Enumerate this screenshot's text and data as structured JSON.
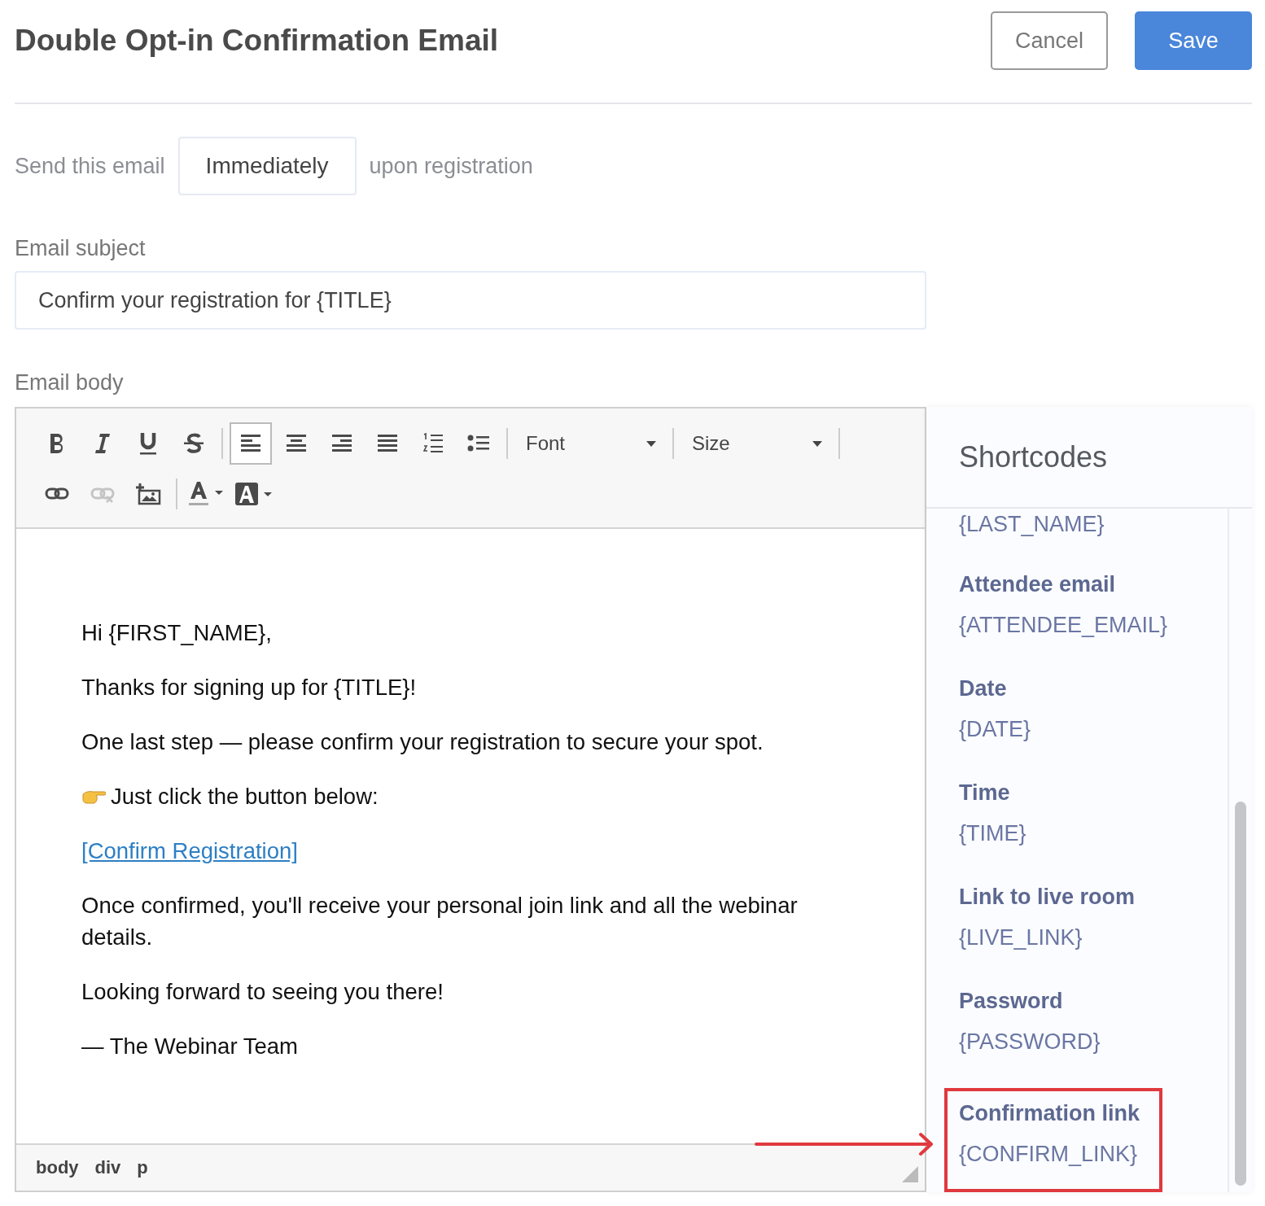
{
  "header": {
    "title": "Double Opt-in Confirmation Email",
    "buttons": [
      {
        "label": "Cancel",
        "kind": "secondary"
      },
      {
        "label": "Save",
        "kind": "primary"
      }
    ]
  },
  "timing": {
    "before": "Send this email",
    "value": "Immediately",
    "after": "upon registration"
  },
  "subject": {
    "label": "Email subject",
    "value": "Confirm your registration for {TITLE}"
  },
  "body_label": "Email body",
  "toolbar": {
    "rows": [
      [
        {
          "kind": "button",
          "selected": false
        },
        {
          "kind": "button",
          "selected": false
        },
        {
          "kind": "button",
          "selected": false
        },
        {
          "kind": "button",
          "selected": false
        },
        {
          "kind": "separator"
        },
        {
          "kind": "button",
          "selected": true
        },
        {
          "kind": "button",
          "selected": false
        },
        {
          "kind": "button",
          "selected": false
        },
        {
          "kind": "button",
          "selected": false
        },
        {
          "kind": "button",
          "selected": false
        },
        {
          "kind": "button",
          "selected": false
        },
        {
          "kind": "separator"
        },
        {
          "kind": "dropdown",
          "label": "Font"
        },
        {
          "kind": "separator"
        },
        {
          "kind": "dropdown",
          "label": "Size"
        },
        {
          "kind": "separator"
        }
      ],
      [
        {
          "kind": "button",
          "selected": false
        },
        {
          "kind": "button",
          "selected": false,
          "disabled": true
        },
        {
          "kind": "button",
          "selected": false
        },
        {
          "kind": "separator"
        },
        {
          "kind": "button",
          "selected": false
        },
        {
          "kind": "button",
          "selected": false
        }
      ]
    ]
  },
  "body": [
    {
      "kind": "text",
      "text": "Hi {FIRST_NAME},"
    },
    {
      "kind": "text",
      "text": "Thanks for signing up for {TITLE}!"
    },
    {
      "kind": "text",
      "text": "One last step — please confirm your registration to secure your spot."
    },
    {
      "kind": "pointer",
      "text": "Just click the button below:"
    },
    {
      "kind": "link",
      "text": "[Confirm Registration]"
    },
    {
      "kind": "text",
      "text": "Once confirmed, you'll receive your personal join link and all the webinar details."
    },
    {
      "kind": "text",
      "text": "Looking forward to seeing you there!"
    },
    {
      "kind": "text",
      "text": "— The Webinar Team"
    }
  ],
  "status_path": [
    "body",
    "div",
    "p"
  ],
  "shortcodes": {
    "title": "Shortcodes",
    "items": [
      {
        "code": "{LAST_NAME}",
        "highlighted": false
      },
      {
        "label": "Attendee email",
        "code": "{ATTENDEE_EMAIL}",
        "highlighted": false
      },
      {
        "label": "Date",
        "code": "{DATE}",
        "highlighted": false
      },
      {
        "label": "Time",
        "code": "{TIME}",
        "highlighted": false
      },
      {
        "label": "Link to live room",
        "code": "{LIVE_LINK}",
        "highlighted": false
      },
      {
        "label": "Password",
        "code": "{PASSWORD}",
        "highlighted": false
      },
      {
        "label": "Confirmation link",
        "code": "{CONFIRM_LINK}",
        "highlighted": true
      }
    ]
  }
}
